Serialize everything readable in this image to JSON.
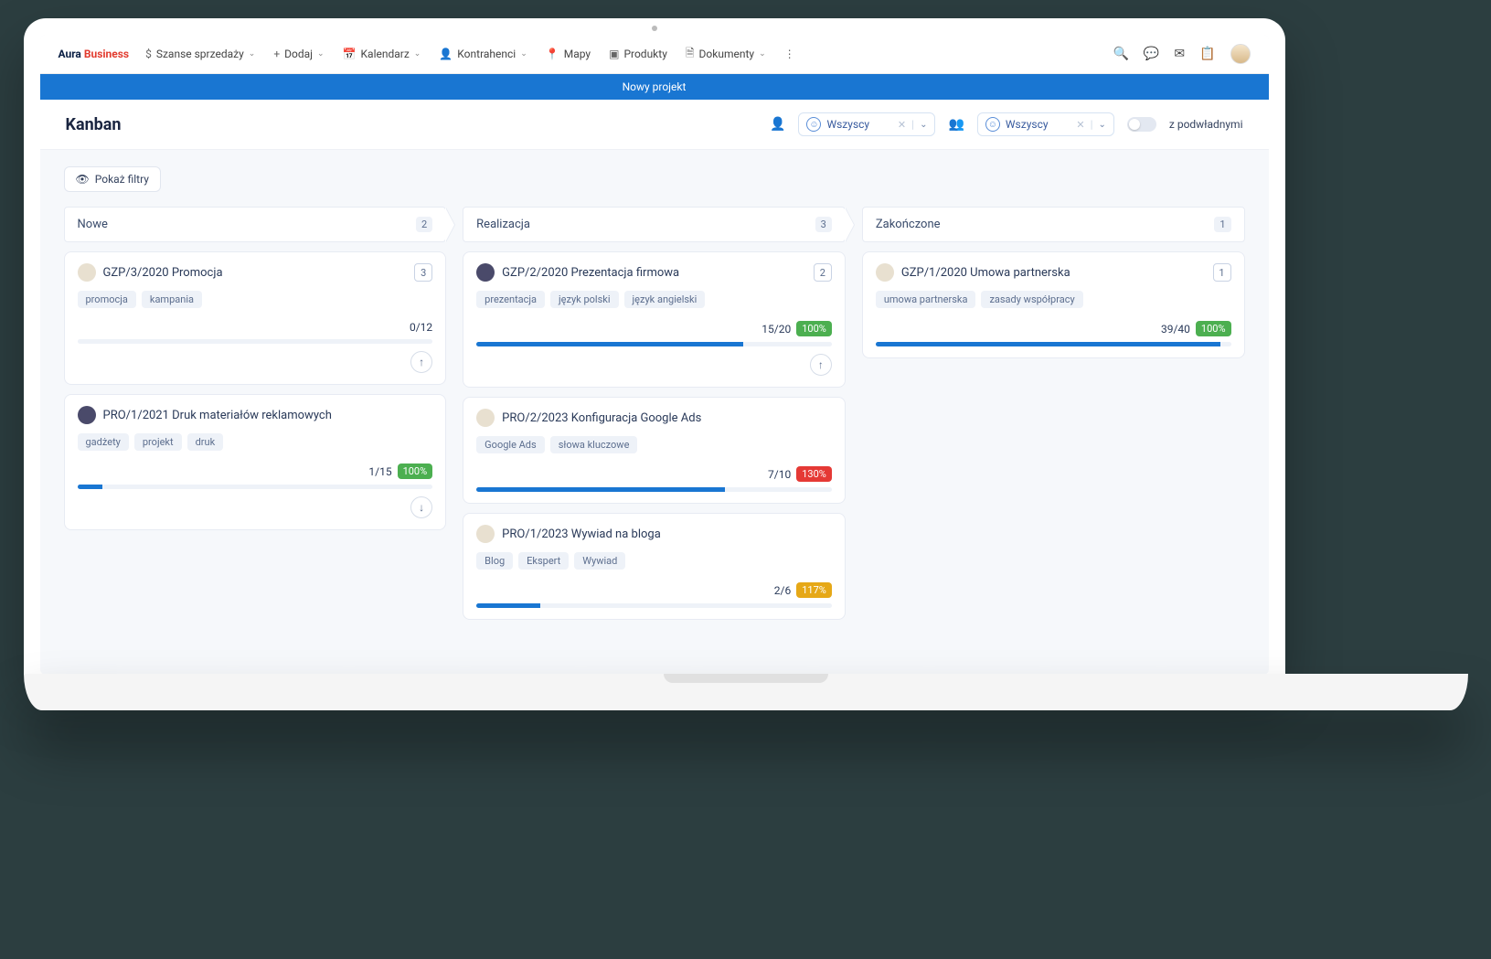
{
  "logo": {
    "part1": "Aura",
    "part2": "Business"
  },
  "nav": {
    "sales": "Szanse sprzedaży",
    "add": "Dodaj",
    "calendar": "Kalendarz",
    "contractors": "Kontrahenci",
    "maps": "Mapy",
    "products": "Produkty",
    "documents": "Dokumenty"
  },
  "blue_bar": "Nowy projekt",
  "page": {
    "title": "Kanban",
    "select1": "Wszyscy",
    "select2": "Wszyscy",
    "subordinates": "z podwładnymi",
    "show_filters": "Pokaż filtry"
  },
  "columns": [
    {
      "name": "Nowe",
      "count": "2",
      "cards": [
        {
          "title": "GZP/3/2020 Promocja",
          "badge": "3",
          "tags": [
            "promocja",
            "kampania"
          ],
          "progress_text": "0/12",
          "pct": null,
          "fill": 0,
          "arrow": "up"
        },
        {
          "title": "PRO/1/2021 Druk materiałów reklamowych",
          "badge": null,
          "tags": [
            "gadżety",
            "projekt",
            "druk"
          ],
          "progress_text": "1/15",
          "pct": "100%",
          "pct_class": "green",
          "fill": 7,
          "arrow": "down",
          "avatar": "dark"
        }
      ]
    },
    {
      "name": "Realizacja",
      "count": "3",
      "cards": [
        {
          "title": "GZP/2/2020 Prezentacja firmowa",
          "badge": "2",
          "tags": [
            "prezentacja",
            "język polski",
            "język angielski"
          ],
          "progress_text": "15/20",
          "pct": "100%",
          "pct_class": "green",
          "fill": 75,
          "arrow": "up",
          "avatar": "dark"
        },
        {
          "title": "PRO/2/2023 Konfiguracja Google Ads",
          "badge": null,
          "tags": [
            "Google Ads",
            "słowa kluczowe"
          ],
          "progress_text": "7/10",
          "pct": "130%",
          "pct_class": "red",
          "fill": 70
        },
        {
          "title": "PRO/1/2023 Wywiad na bloga",
          "badge": null,
          "tags": [
            "Blog",
            "Ekspert",
            "Wywiad"
          ],
          "progress_text": "2/6",
          "pct": "117%",
          "pct_class": "yellow",
          "fill": 18
        }
      ]
    },
    {
      "name": "Zakończone",
      "count": "1",
      "cards": [
        {
          "title": "GZP/1/2020 Umowa partnerska",
          "badge": "1",
          "tags": [
            "umowa partnerska",
            "zasady współpracy"
          ],
          "progress_text": "39/40",
          "pct": "100%",
          "pct_class": "green",
          "fill": 97
        }
      ]
    }
  ]
}
